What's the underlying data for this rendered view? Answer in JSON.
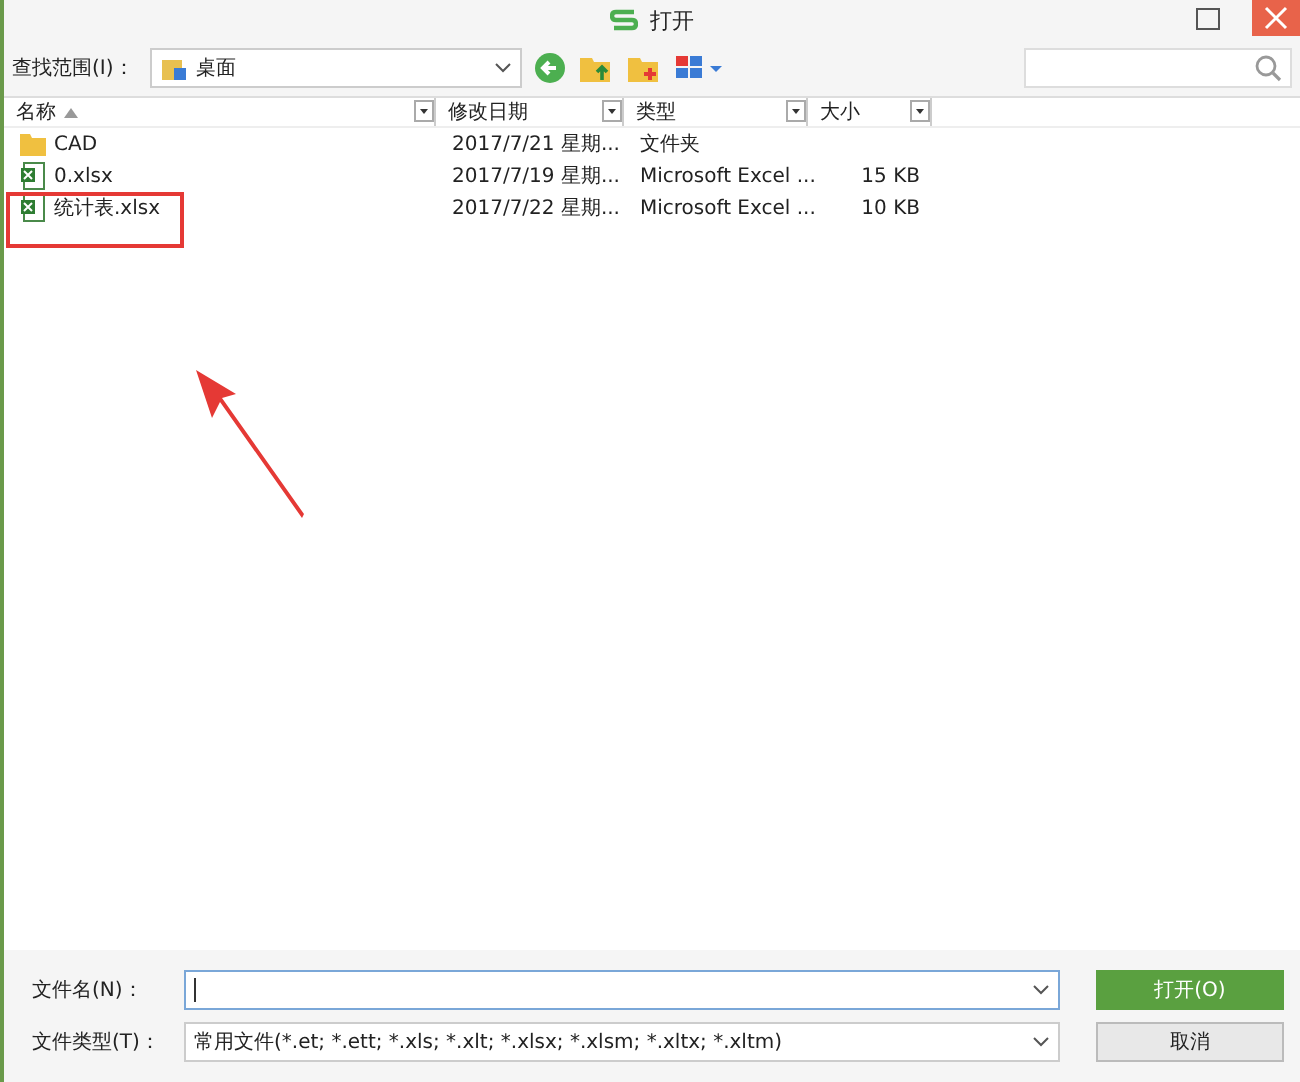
{
  "window": {
    "title": "打开"
  },
  "toolbar": {
    "location_label": "查找范围(I)：",
    "location": "桌面"
  },
  "table": {
    "columns": [
      "名称",
      "修改日期",
      "类型",
      "大小"
    ],
    "rows": [
      {
        "kind": "folder",
        "name": "CAD",
        "date": "2017/7/21 星期...",
        "type": "文件夹",
        "size": ""
      },
      {
        "kind": "excel",
        "name": "0.xlsx",
        "date": "2017/7/19 星期...",
        "type": "Microsoft Excel ...",
        "size": "15 KB"
      },
      {
        "kind": "excel",
        "name": "统计表.xlsx",
        "date": "2017/7/22 星期...",
        "type": "Microsoft Excel ...",
        "size": "10 KB"
      }
    ]
  },
  "filename": {
    "label": "文件名(N)："
  },
  "filetype": {
    "label": "文件类型(T)：",
    "value": "常用文件(*.et; *.ett; *.xls; *.xlt; *.xlsx; *.xlsm; *.xltx; *.xltm)"
  },
  "buttons": {
    "open": "打开(O)",
    "cancel": "取消"
  }
}
